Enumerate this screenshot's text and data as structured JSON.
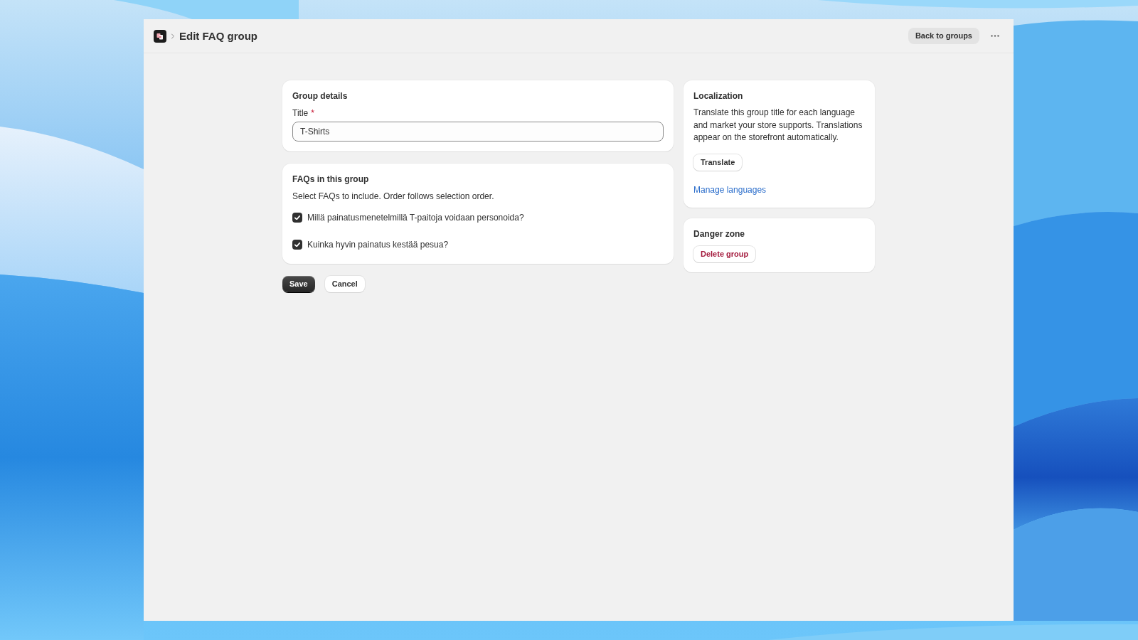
{
  "header": {
    "title": "Edit FAQ group",
    "back_button": "Back to groups"
  },
  "group_details": {
    "heading": "Group details",
    "title_field": {
      "label": "Title",
      "required_mark": "*",
      "value": "T-Shirts"
    }
  },
  "faqs": {
    "heading": "FAQs in this group",
    "description": "Select FAQs to include. Order follows selection order.",
    "items": [
      {
        "label": "Millä painatusmenetelmillä T-paitoja voidaan personoida?",
        "checked": true
      },
      {
        "label": "Kuinka hyvin painatus kestää pesua?",
        "checked": true
      }
    ]
  },
  "form_actions": [
    {
      "label": "Save",
      "kind": "primary"
    },
    {
      "label": "Cancel",
      "kind": "secondary"
    }
  ],
  "localization": {
    "heading": "Localization",
    "description": "Translate this group title for each language and market your store supports. Translations appear on the storefront automatically.",
    "button": "Translate",
    "link": "Manage languages"
  },
  "danger_zone": {
    "heading": "Danger zone",
    "button": "Delete group"
  }
}
